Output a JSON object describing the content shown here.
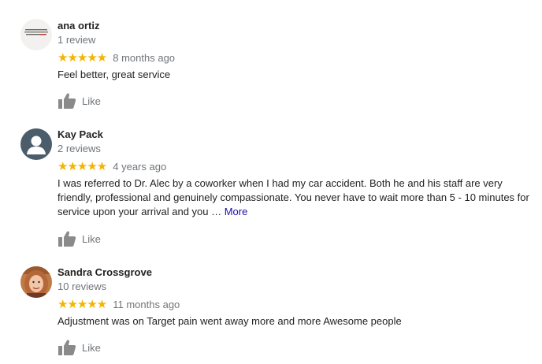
{
  "reviews": [
    {
      "name": "ana ortiz",
      "review_count": "1 review",
      "stars": "★★★★★",
      "date": "8 months ago",
      "text": "Feel better, great service",
      "more": "",
      "like_label": "Like"
    },
    {
      "name": "Kay Pack",
      "review_count": "2 reviews",
      "stars": "★★★★★",
      "date": "4 years ago",
      "text": "I  was referred to Dr. Alec by a coworker when I had my car accident. Both he and his staff are very friendly, professional and genuinely compassionate. You never have to wait more than 5 - 10 minutes for service upon your arrival and you … ",
      "more": "More",
      "like_label": "Like"
    },
    {
      "name": "Sandra Crossgrove",
      "review_count": "10 reviews",
      "stars": "★★★★★",
      "date": "11 months ago",
      "text": "Adjustment was on Target pain went away more and more Awesome people",
      "more": "",
      "like_label": "Like"
    }
  ],
  "colors": {
    "star": "#f4b400",
    "link": "#1a0dab",
    "muted": "#70757a"
  }
}
